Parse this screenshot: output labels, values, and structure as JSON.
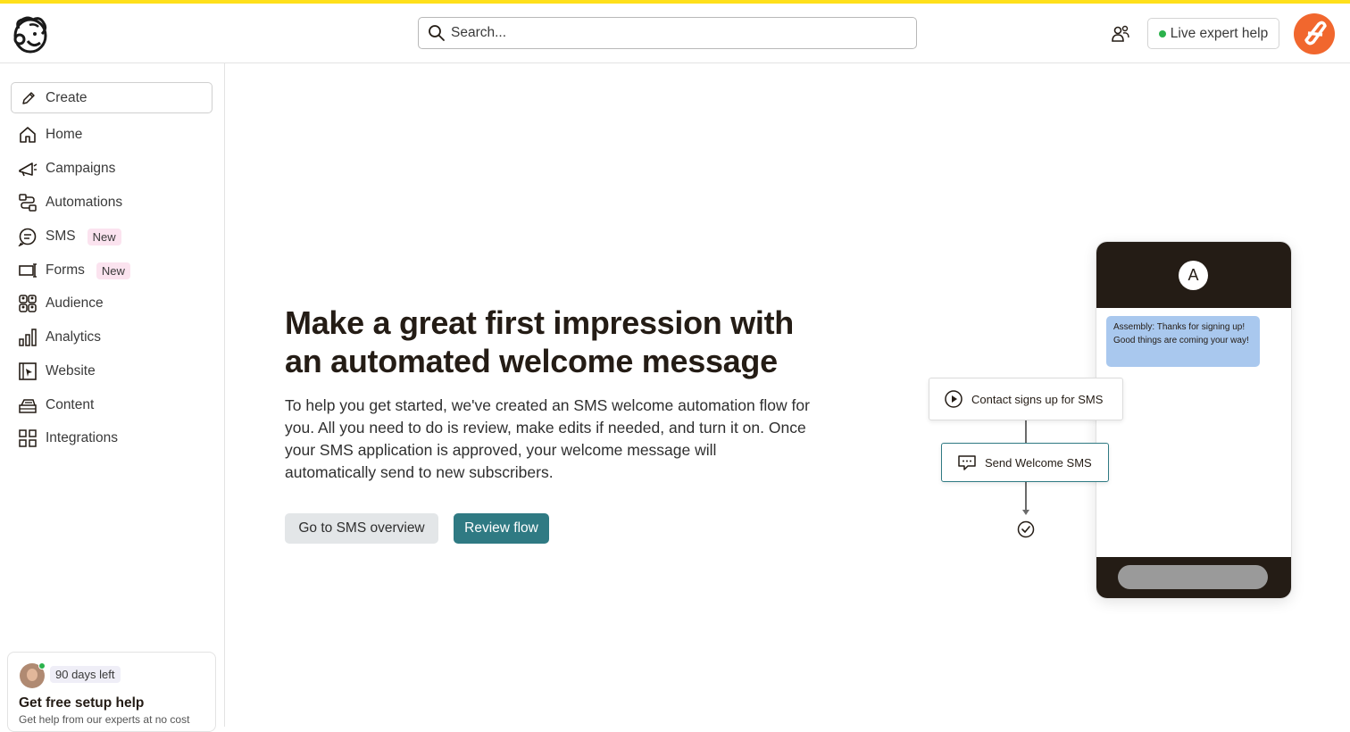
{
  "colors": {
    "accent_yellow": "#ffe01b",
    "primary_button": "#2f7a83",
    "secondary_button": "#e3e6e8",
    "online_dot": "#2bb24c",
    "new_badge": "#fbe3ef",
    "brand_orange": "#f1672e"
  },
  "header": {
    "search": {
      "placeholder": "Search..."
    },
    "live_help_label": "Live expert help"
  },
  "sidebar": {
    "create_label": "Create",
    "items": [
      {
        "label": "Home",
        "icon": "home-icon"
      },
      {
        "label": "Campaigns",
        "icon": "megaphone-icon"
      },
      {
        "label": "Automations",
        "icon": "automations-icon"
      },
      {
        "label": "SMS",
        "icon": "sms-icon",
        "badge": "New"
      },
      {
        "label": "Forms",
        "icon": "forms-icon",
        "badge": "New"
      },
      {
        "label": "Audience",
        "icon": "audience-icon"
      },
      {
        "label": "Analytics",
        "icon": "analytics-icon"
      },
      {
        "label": "Website",
        "icon": "website-icon"
      },
      {
        "label": "Content",
        "icon": "content-icon"
      },
      {
        "label": "Integrations",
        "icon": "integrations-icon"
      }
    ],
    "setup_card": {
      "days_left": "90 days left",
      "title": "Get free setup help",
      "subtitle": "Get help from our experts at no cost"
    }
  },
  "main": {
    "title": "Make a great first impression with an automated welcome message",
    "body": "To help you get started, we've created an SMS welcome automation flow for you. All you need to do is review, make edits if needed, and turn it on. Once your SMS application is approved, your welcome message will automatically send to new subscribers.",
    "secondary_button": "Go to SMS overview",
    "primary_button": "Review flow"
  },
  "illustration": {
    "phone_avatar_letter": "A",
    "message": "Assembly: Thanks for signing up! Good things are coming your way!",
    "flow_trigger": "Contact signs up for SMS",
    "flow_action": "Send Welcome SMS"
  }
}
